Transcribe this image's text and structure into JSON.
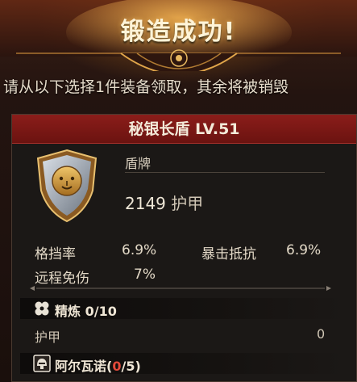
{
  "banner": {
    "title": "锻造成功!"
  },
  "subtitle": "请从以下选择1件装备领取，其余将被销毁",
  "item": {
    "name": "秘银长盾 LV.51",
    "type": "盾牌",
    "armor_value": "2149",
    "armor_label": "护甲"
  },
  "stats": [
    {
      "label": "格挡率",
      "value": "6.9%"
    },
    {
      "label": "暴击抵抗",
      "value": "6.9%"
    },
    {
      "label": "远程免伤",
      "value": "7%"
    }
  ],
  "refine": {
    "label": "精炼",
    "value": "0/10",
    "stat_label": "护甲",
    "stat_value": "0"
  },
  "set_bonus": {
    "name": "阿尔瓦诺",
    "open": "(",
    "count": "0",
    "tail": "/5)"
  },
  "colors": {
    "header_red": "#8b1d1a",
    "accent_gold": "#d8a640",
    "set_count_red": "#e34a3a"
  },
  "icons": [
    "shield-lion-icon",
    "refine-gems-icon",
    "set-helmet-icon",
    "banner-frame-icon"
  ]
}
